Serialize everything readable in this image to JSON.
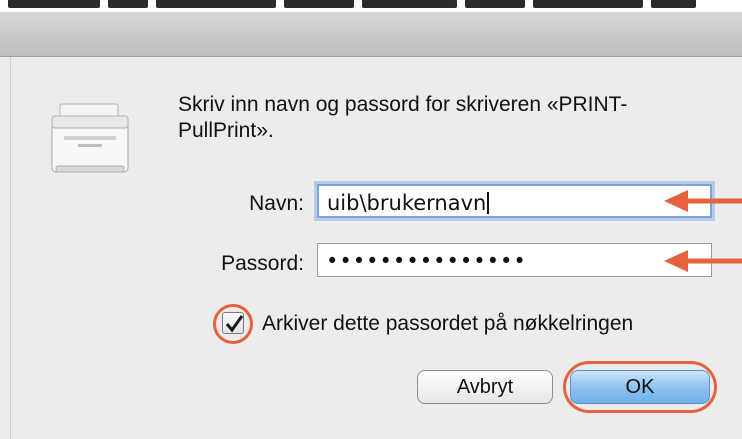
{
  "dialog": {
    "message": "Skriv inn navn og passord for skriveren «PRINT-PullPrint».",
    "name_label": "Navn:",
    "name_value": "uib\\brukernavn",
    "password_label": "Passord:",
    "password_value": "•••••••••••••••",
    "remember_checked": true,
    "remember_label": "Arkiver dette passordet på nøkkelringen",
    "cancel_label": "Avbryt",
    "ok_label": "OK"
  },
  "icons": {
    "printer": "printer-icon",
    "checkmark": "checkmark-icon",
    "arrow": "arrow-left-icon"
  },
  "colors": {
    "annotation": "#e4623e",
    "focus_ring": "#78a6d8",
    "default_button": "#6eb0ec"
  }
}
